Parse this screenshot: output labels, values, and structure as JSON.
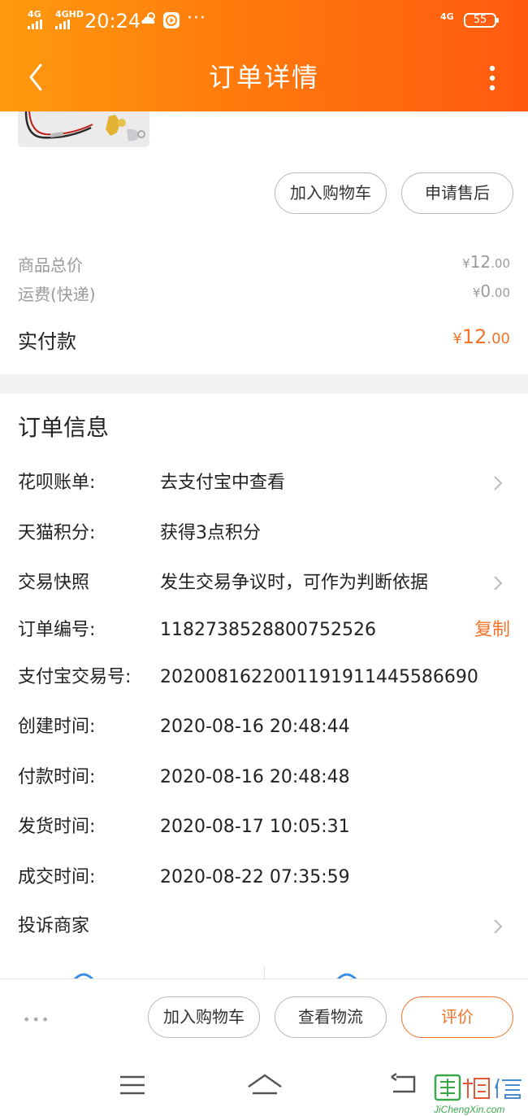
{
  "status_bar": {
    "sig1_label": "4G",
    "sig2_label": "4GHD",
    "time": "20:24",
    "right_label": "4G",
    "battery": "55"
  },
  "nav": {
    "title": "订单详情"
  },
  "item_actions": {
    "add_cart": "加入购物车",
    "after_sale": "申请售后"
  },
  "price": {
    "goods_total_label": "商品总价",
    "goods_total": {
      "symbol": "¥",
      "integer": "12",
      "decimal": ".00"
    },
    "shipping_label": "运费(快递)",
    "shipping": {
      "symbol": "¥",
      "integer": "0",
      "decimal": ".00"
    },
    "paid_label": "实付款",
    "paid": {
      "symbol": "¥",
      "integer": "12",
      "decimal": ".00"
    }
  },
  "order_info": {
    "title": "订单信息",
    "rows": [
      {
        "label": "花呗账单:",
        "value": "去支付宝中查看"
      },
      {
        "label": "天猫积分:",
        "value": "获得3点积分"
      },
      {
        "label": "交易快照",
        "value": "发生交易争议时，可作为判断依据"
      },
      {
        "label": "订单编号:",
        "value": "1182738528800752526",
        "action": "复制"
      },
      {
        "label": "支付宝交易号:",
        "value": "2020081622001191911445586690"
      },
      {
        "label": "创建时间:",
        "value": "2020-08-16 20:48:44"
      },
      {
        "label": "付款时间:",
        "value": "2020-08-16 20:48:48"
      },
      {
        "label": "发货时间:",
        "value": "2020-08-17 10:05:31"
      },
      {
        "label": "成交时间:",
        "value": "2020-08-22 07:35:59"
      },
      {
        "label": "投诉商家",
        "value": ""
      }
    ]
  },
  "bottom_bar": {
    "more": "•••",
    "add_cart": "加入购物车",
    "logistics": "查看物流",
    "review": "评价"
  },
  "watermark": {
    "cn": "集诚信",
    "en": "JiChengXin.com"
  },
  "colors": {
    "accent": "#f2742a",
    "header_start": "#ff9a0e",
    "header_end": "#ff5a10"
  }
}
